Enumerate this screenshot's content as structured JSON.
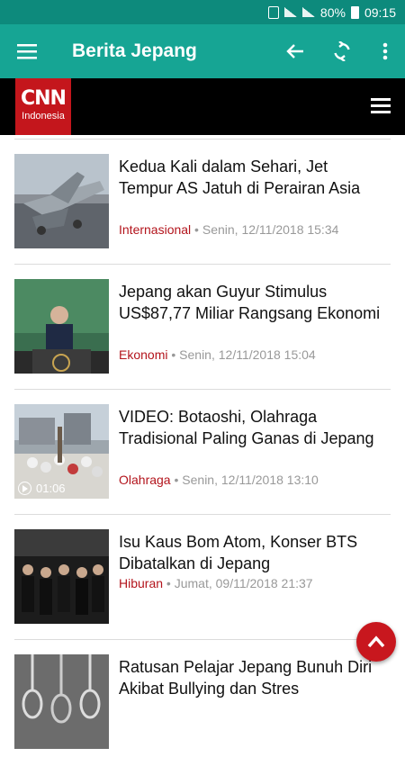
{
  "status": {
    "battery": "80%",
    "time": "09:15"
  },
  "appbar": {
    "title": "Berita Jepang"
  },
  "brand": {
    "name": "CNN",
    "sub": "Indonesia"
  },
  "articles": [
    {
      "title": "Kedua Kali dalam Sehari, Jet Tempur AS Jatuh di Perairan Asia",
      "category": "Internasional",
      "date": "Senin, 12/11/2018 15:34",
      "thumb": "jet"
    },
    {
      "title": "Jepang akan Guyur Stimulus US$87,77 Miliar Rangsang Ekonomi",
      "category": "Ekonomi",
      "date": "Senin, 12/11/2018 15:04",
      "thumb": "speech"
    },
    {
      "title": "VIDEO: Botaoshi, Olahraga Tradisional Paling Ganas di Jepang",
      "category": "Olahraga",
      "date": "Senin, 12/11/2018 13:10",
      "thumb": "crowd",
      "video_duration": "01:06"
    },
    {
      "title": "Isu Kaus Bom Atom, Konser BTS Dibatalkan di Jepang",
      "category": "Hiburan",
      "date": "Jumat, 09/11/2018 21:37",
      "thumb": "band"
    },
    {
      "title": "Ratusan Pelajar Jepang Bunuh Diri Akibat Bullying dan Stres",
      "category": "",
      "date": "",
      "thumb": "rope"
    }
  ],
  "colors": {
    "statusbar": "#0d8a7c",
    "appbar": "#16a594",
    "brand_red": "#c4161c",
    "category": "#b3141c"
  }
}
